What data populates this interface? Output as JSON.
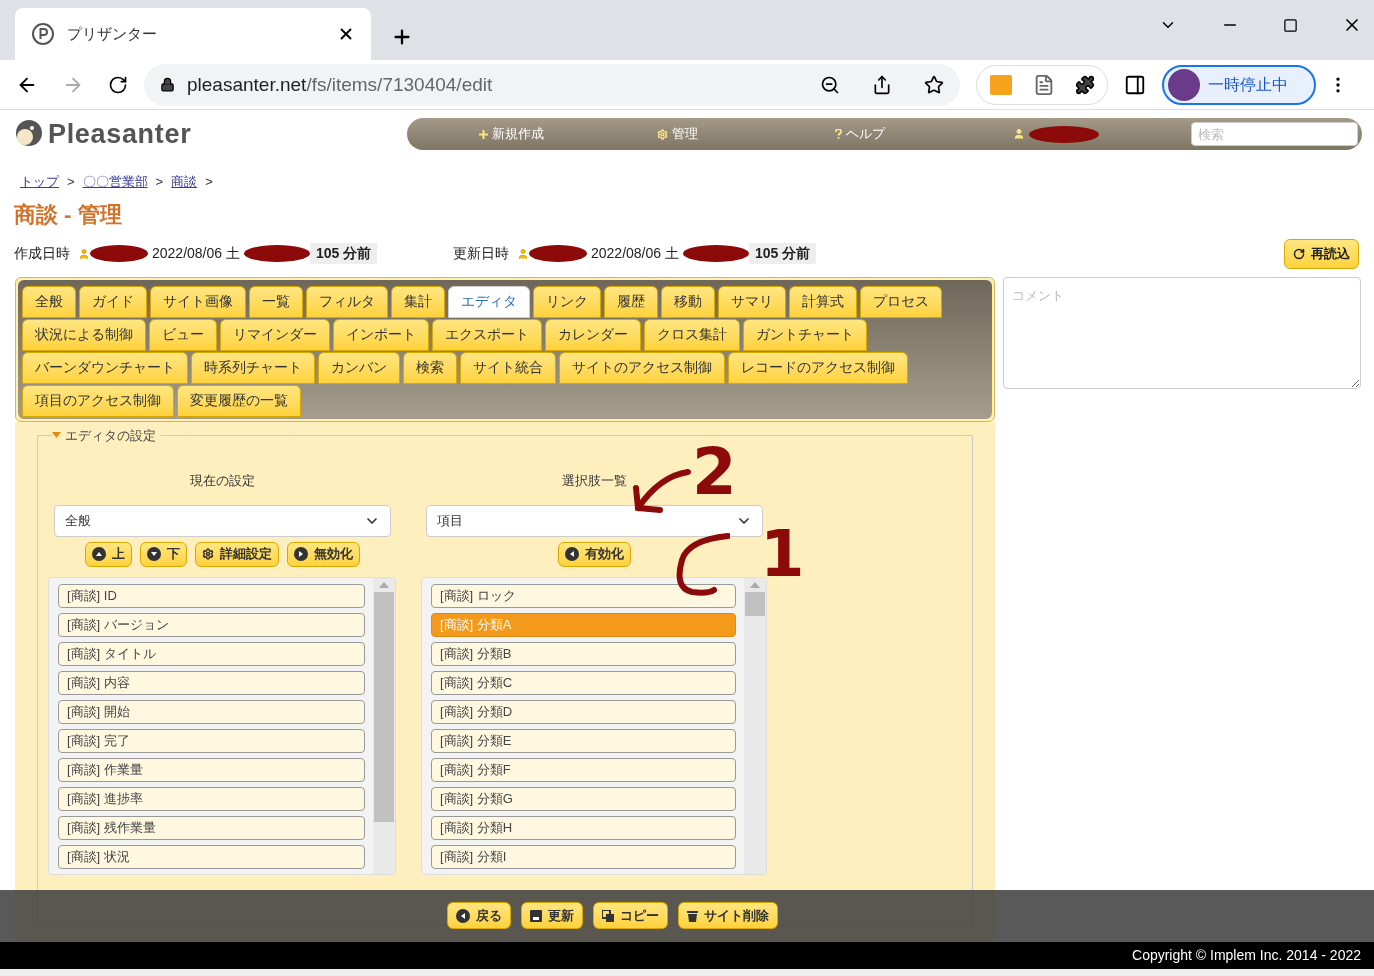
{
  "browser": {
    "tab_title": "プリザンター",
    "url_host": "pleasanter.net",
    "url_path": "/fs/items/7130404/edit",
    "profile_label": "一時停止中"
  },
  "header": {
    "logo": "Pleasanter",
    "nav": [
      {
        "kind": "plus",
        "label": "新規作成"
      },
      {
        "kind": "gear",
        "label": "管理"
      },
      {
        "kind": "help",
        "label": "ヘルプ"
      },
      {
        "kind": "user"
      }
    ],
    "search_placeholder": "検索"
  },
  "breadcrumb": [
    {
      "label": "トップ",
      "separator": ">"
    },
    {
      "label": "〇〇営業部",
      "separator": ">"
    },
    {
      "label": "商談",
      "separator": ">"
    }
  ],
  "title": "商談 - 管理",
  "meta": [
    {
      "label": "作成日時",
      "date": "2022/08/06 土",
      "ago": "105 分前"
    },
    {
      "label": "更新日時",
      "date": "2022/08/06 土",
      "ago": "105 分前"
    }
  ],
  "reload_button": "再読込",
  "comment_placeholder": "コメント",
  "tab_rows": [
    [
      {
        "label": "全般",
        "selected": false
      },
      {
        "label": "ガイド",
        "selected": false
      },
      {
        "label": "サイト画像",
        "selected": false
      },
      {
        "label": "一覧",
        "selected": false
      },
      {
        "label": "フィルタ",
        "selected": false
      },
      {
        "label": "集計",
        "selected": false
      },
      {
        "label": "エディタ",
        "selected": true
      },
      {
        "label": "リンク",
        "selected": false
      },
      {
        "label": "履歴",
        "selected": false
      },
      {
        "label": "移動",
        "selected": false
      },
      {
        "label": "サマリ",
        "selected": false
      },
      {
        "label": "計算式",
        "selected": false
      },
      {
        "label": "プロセス",
        "selected": false
      }
    ],
    [
      {
        "label": "状況による制御",
        "selected": false
      },
      {
        "label": "ビュー",
        "selected": false
      },
      {
        "label": "リマインダー",
        "selected": false
      },
      {
        "label": "インポート",
        "selected": false
      },
      {
        "label": "エクスポート",
        "selected": false
      },
      {
        "label": "カレンダー",
        "selected": false
      },
      {
        "label": "クロス集計",
        "selected": false
      },
      {
        "label": "ガントチャート",
        "selected": false
      }
    ],
    [
      {
        "label": "バーンダウンチャート",
        "selected": false
      },
      {
        "label": "時系列チャート",
        "selected": false
      },
      {
        "label": "カンバン",
        "selected": false
      },
      {
        "label": "検索",
        "selected": false
      },
      {
        "label": "サイト統合",
        "selected": false
      },
      {
        "label": "サイトのアクセス制御",
        "selected": false
      },
      {
        "label": "レコードのアクセス制御",
        "selected": false
      }
    ],
    [
      {
        "label": "項目のアクセス制御",
        "selected": false
      },
      {
        "label": "変更履歴の一覧",
        "selected": false
      }
    ]
  ],
  "editor": {
    "legend": "エディタの設定",
    "current": {
      "heading": "現在の設定",
      "select_value": "全般",
      "buttons": [
        {
          "kind": "up",
          "label": "上"
        },
        {
          "kind": "down",
          "label": "下"
        },
        {
          "kind": "gear",
          "label": "詳細設定"
        },
        {
          "kind": "right",
          "label": "無効化"
        }
      ],
      "items": [
        {
          "label": "[商談] ID",
          "selected": false
        },
        {
          "label": "[商談] バージョン",
          "selected": false
        },
        {
          "label": "[商談] タイトル",
          "selected": false
        },
        {
          "label": "[商談] 内容",
          "selected": false
        },
        {
          "label": "[商談] 開始",
          "selected": false
        },
        {
          "label": "[商談] 完了",
          "selected": false
        },
        {
          "label": "[商談] 作業量",
          "selected": false
        },
        {
          "label": "[商談] 進捗率",
          "selected": false
        },
        {
          "label": "[商談] 残作業量",
          "selected": false
        },
        {
          "label": "[商談] 状況",
          "selected": false
        }
      ]
    },
    "options": {
      "heading": "選択肢一覧",
      "select_value": "項目",
      "buttons": [
        {
          "kind": "left",
          "label": "有効化"
        }
      ],
      "items": [
        {
          "label": "[商談] ロック",
          "selected": false
        },
        {
          "label": "[商談] 分類A",
          "selected": true
        },
        {
          "label": "[商談] 分類B",
          "selected": false
        },
        {
          "label": "[商談] 分類C",
          "selected": false
        },
        {
          "label": "[商談] 分類D",
          "selected": false
        },
        {
          "label": "[商談] 分類E",
          "selected": false
        },
        {
          "label": "[商談] 分類F",
          "selected": false
        },
        {
          "label": "[商談] 分類G",
          "selected": false
        },
        {
          "label": "[商談] 分類H",
          "selected": false
        },
        {
          "label": "[商談] 分類I",
          "selected": false
        }
      ]
    }
  },
  "annotations": [
    {
      "label": "2"
    },
    {
      "label": "1"
    }
  ],
  "footer_buttons": [
    {
      "kind": "back",
      "label": "戻る"
    },
    {
      "kind": "save",
      "label": "更新"
    },
    {
      "kind": "copy",
      "label": "コピー"
    },
    {
      "kind": "trash",
      "label": "サイト削除"
    }
  ],
  "copyright": "Copyright © Implem Inc. 2014 - 2022"
}
